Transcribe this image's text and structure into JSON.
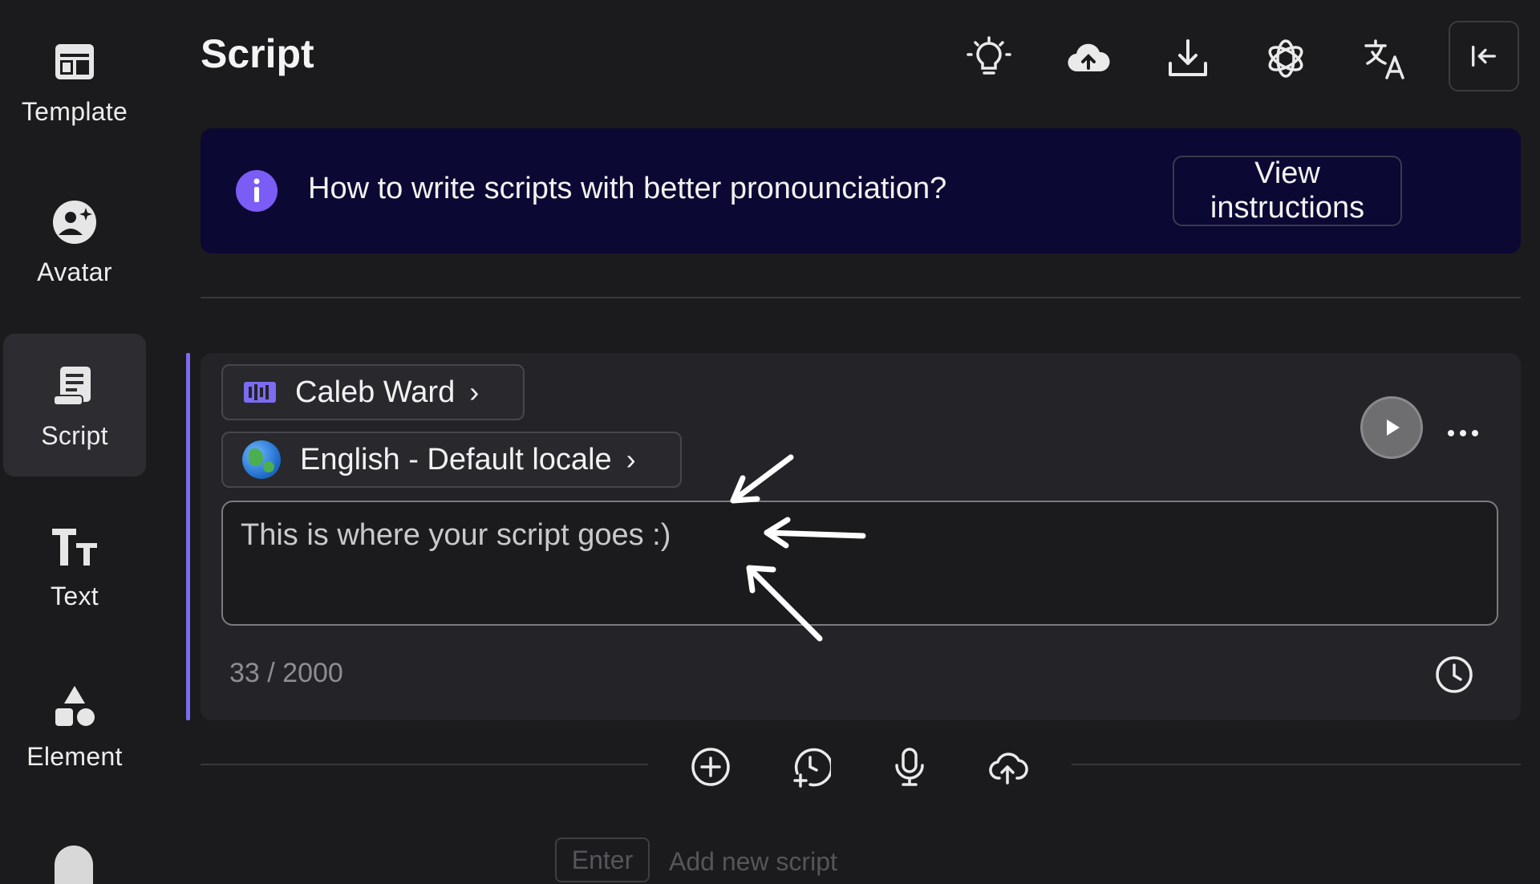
{
  "sidebar": {
    "items": [
      {
        "label": "Template",
        "icon": "template-icon",
        "active": false
      },
      {
        "label": "Avatar",
        "icon": "avatar-icon",
        "active": false
      },
      {
        "label": "Script",
        "icon": "script-icon",
        "active": true
      },
      {
        "label": "Text",
        "icon": "text-icon",
        "active": false
      },
      {
        "label": "Element",
        "icon": "element-icon",
        "active": false
      }
    ]
  },
  "header": {
    "title": "Script",
    "toolbar": [
      "lightbulb-icon",
      "cloud-upload-icon",
      "download-icon",
      "openai-icon",
      "translate-icon",
      "collapse-panel-icon"
    ]
  },
  "banner": {
    "text": "How to write scripts with better pronounciation?",
    "button": "View instructions"
  },
  "script_card": {
    "voice": "Caleb Ward",
    "locale": "English - Default locale",
    "script_text": "This is where your script goes :)",
    "counter": "33 / 2000"
  },
  "bottom_toolbar": [
    "add-circle-icon",
    "history-add-icon",
    "microphone-icon",
    "cloud-upload-icon"
  ],
  "footer_hint": {
    "key": "Enter",
    "text": "Add new script"
  },
  "colors": {
    "background": "#1b1b1d",
    "card": "#242428",
    "banner": "#0b0833",
    "accent": "#7b6cf0",
    "info": "#7b5cf5"
  }
}
